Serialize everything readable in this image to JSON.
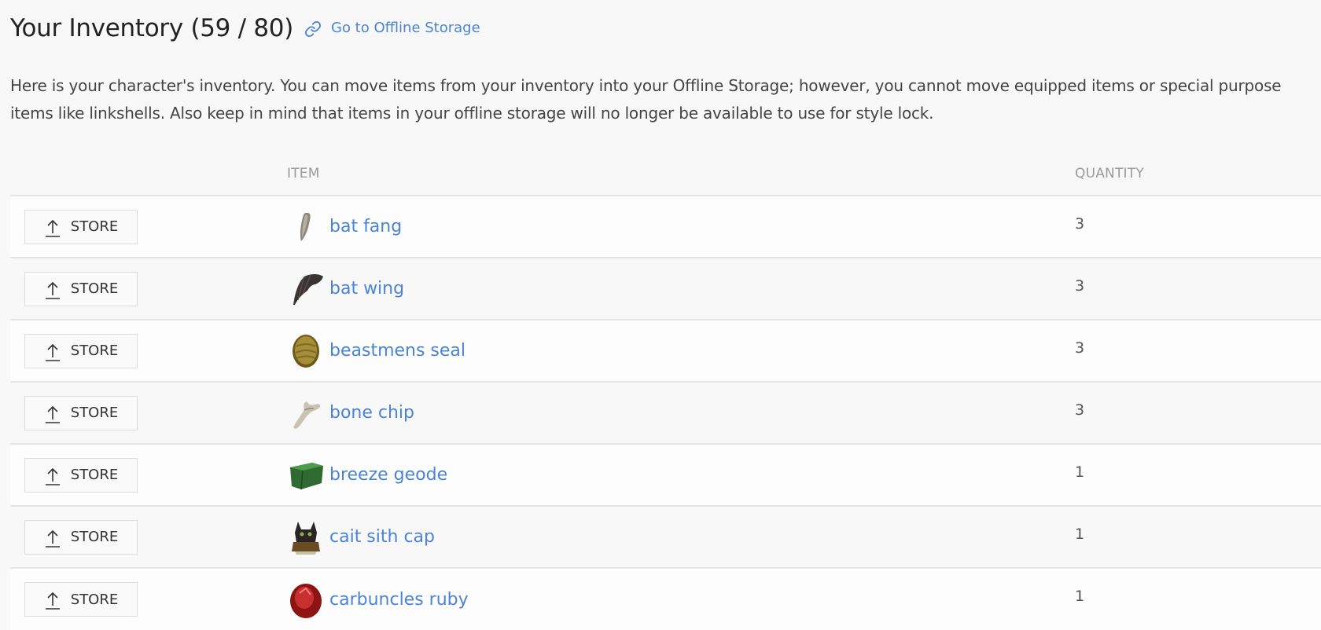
{
  "header": {
    "title": "Your Inventory (59 / 80)",
    "storage_link_icon": "link-icon",
    "storage_link_label": "Go to Offline Storage",
    "link_color": "#4a84d8"
  },
  "description": "Here is your character's inventory. You can move items from your inventory into your Offline Storage; however, you cannot move equipped items or special purpose items like linkshells. Also keep in mind that items in your offline storage will no longer be available to use for style lock.",
  "inventory": {
    "used": 59,
    "capacity": 80,
    "columns": [
      "",
      "ITEM",
      "QUANTITY"
    ],
    "store_button_label": "STORE",
    "store_button_icon": "upload-arrow-icon",
    "rows": [
      {
        "name": "bat fang",
        "icon": "bat-fang-icon",
        "quantity": "3"
      },
      {
        "name": "bat wing",
        "icon": "bat-wing-icon",
        "quantity": "3"
      },
      {
        "name": "beastmens seal",
        "icon": "beastmens-seal-icon",
        "quantity": "3"
      },
      {
        "name": "bone chip",
        "icon": "bone-chip-icon",
        "quantity": "3"
      },
      {
        "name": "breeze geode",
        "icon": "breeze-geode-icon",
        "quantity": "1"
      },
      {
        "name": "cait sith cap",
        "icon": "cait-sith-cap-icon",
        "quantity": "1"
      },
      {
        "name": "carbuncles ruby",
        "icon": "carbuncles-ruby-icon",
        "quantity": "1"
      }
    ]
  }
}
